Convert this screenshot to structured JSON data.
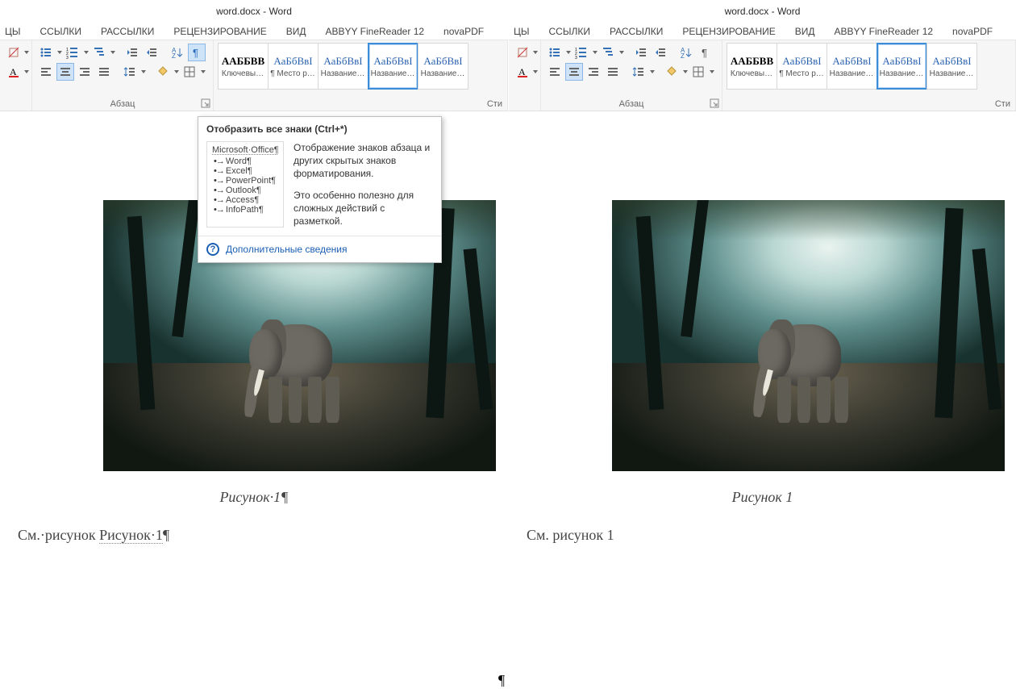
{
  "title": "word.docx - Word",
  "tabs": [
    "ЦЫ",
    "ССЫЛКИ",
    "РАССЫЛКИ",
    "РЕЦЕНЗИРОВАНИЕ",
    "ВИД",
    "ABBYY FineReader 12",
    "novaPDF"
  ],
  "paragraph_group_label": "Абзац",
  "styles_group_label": "Сти",
  "styles": {
    "previews": [
      "ААББВВ",
      "АаБбВвI",
      "АаБбВвI",
      "АаБбВвI",
      "АаБбВвI"
    ],
    "names": [
      "Ключевы…",
      "¶ Место р…",
      "Название…",
      "Название…",
      "Название…"
    ],
    "selected_index_left": 3,
    "selected_index_right": 3
  },
  "tooltip": {
    "title": "Отобразить все знаки (Ctrl+*)",
    "sample_title": "Microsoft·Office¶",
    "sample_items": [
      "Word¶",
      "Excel¶",
      "PowerPoint¶",
      "Outlook¶",
      "Access¶",
      "InfoPath¶"
    ],
    "desc1": "Отображение знаков абзаца и других скрытых знаков форматирования.",
    "desc2": "Это особенно полезно для сложных действий с разметкой.",
    "more": "Дополнительные сведения"
  },
  "doc_left": {
    "caption": "Рисунок·1¶",
    "ref_prefix": "См.·рисунок",
    "ref_field": "Рисунок·1",
    "ref_suffix": "¶",
    "img_pilcrow": "¶"
  },
  "doc_right": {
    "caption": "Рисунок 1",
    "ref": "См. рисунок 1"
  }
}
